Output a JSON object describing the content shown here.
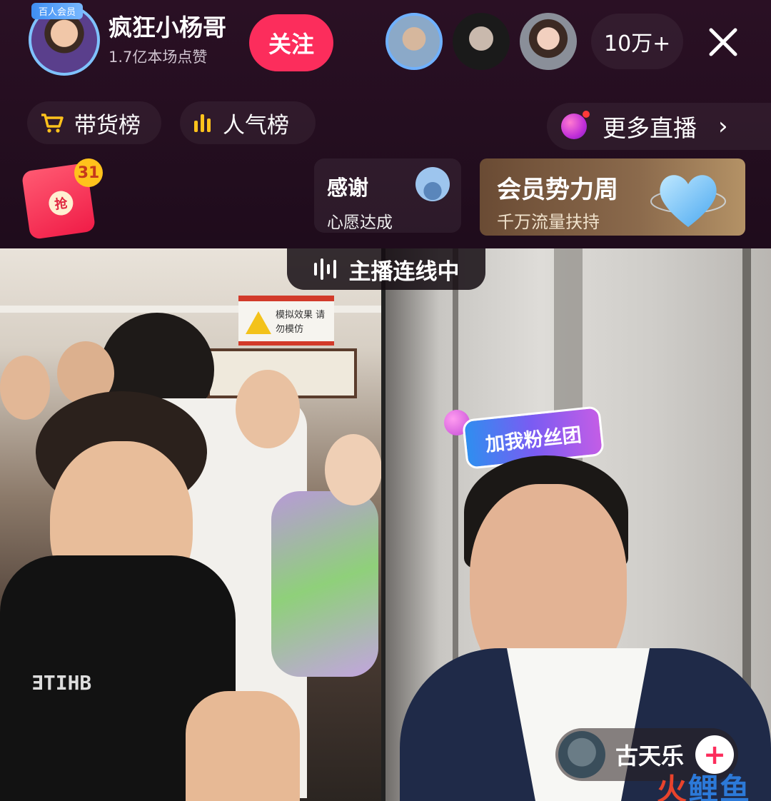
{
  "anchor": {
    "badge": "百人会员",
    "name": "疯狂小杨哥",
    "likes": "1.7亿本场点赞",
    "follow_label": "关注"
  },
  "viewers": {
    "count": "10万+"
  },
  "ranks": {
    "sales_label": "带货榜",
    "popularity_label": "人气榜"
  },
  "more_live": {
    "label": "更多直播",
    "chevron": "›"
  },
  "red_packet": {
    "seal": "抢",
    "badge": "31"
  },
  "wish": {
    "title": "感谢",
    "subtitle": "心愿达成"
  },
  "banner": {
    "title": "会员势力周",
    "subtitle": "千万流量扶持"
  },
  "link": {
    "label": "主播连线中"
  },
  "scene_left": {
    "sign_text": "模拟效果 请勿模仿"
  },
  "scene_right": {
    "fans_badge": "加我粉丝团"
  },
  "guest": {
    "name": "古天乐",
    "follow": "+"
  },
  "watermark": {
    "part1": "火",
    "part2": "鲤鱼"
  },
  "colors": {
    "follow": "#fc2d5c",
    "accent_gold": "#ffc21c"
  }
}
